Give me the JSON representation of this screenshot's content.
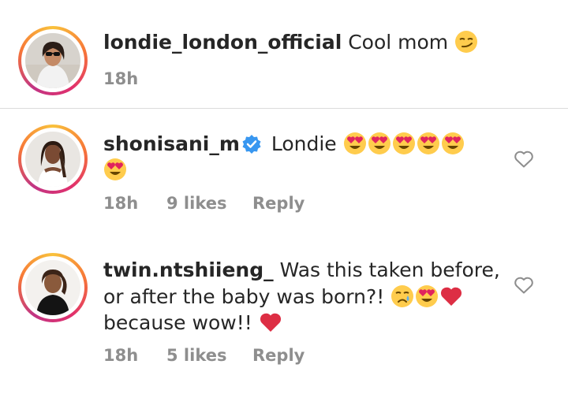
{
  "comments": [
    {
      "username": "londie_london_official",
      "line1": "Cool mom",
      "time": "18h"
    },
    {
      "username": "shonisani_m",
      "line1": "Londie",
      "time": "18h",
      "likes": "9 likes",
      "reply": "Reply"
    },
    {
      "username": "twin.ntshiieng_",
      "line1": "Was this taken before,",
      "line2": "or after the baby was born?!",
      "line3": "because wow!!",
      "time": "18h",
      "likes": "5 likes",
      "reply": "Reply"
    }
  ],
  "icons": {
    "smirk": "smirking-face-emoji",
    "heart_eyes": "heart-eyes-emoji",
    "crying": "crying-face-emoji",
    "red_heart": "red-heart-emoji",
    "verified": "verified-badge-icon",
    "like": "heart-outline-icon"
  },
  "colors": {
    "text": "#262626",
    "meta": "#8e8e8e",
    "verified": "#3897f0",
    "heart": "#e0245e"
  }
}
